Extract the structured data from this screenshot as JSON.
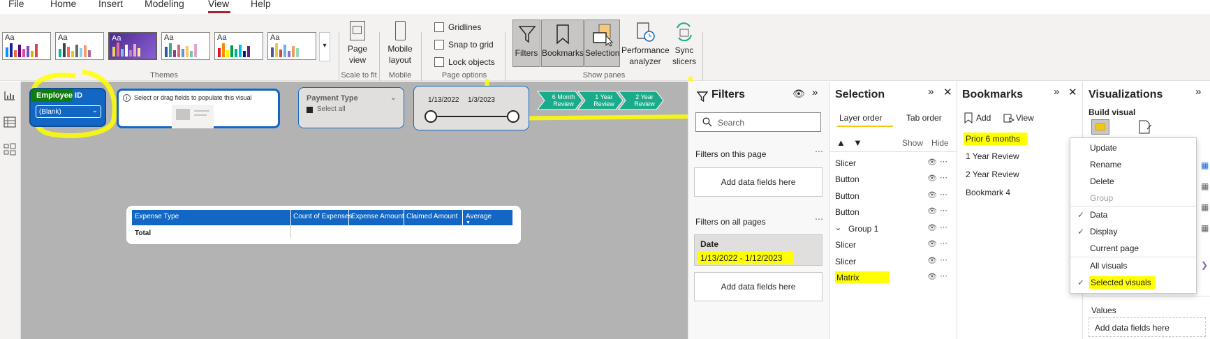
{
  "menu": {
    "file": "File",
    "home": "Home",
    "insert": "Insert",
    "modeling": "Modeling",
    "view": "View",
    "help": "Help"
  },
  "ribbon": {
    "theme_label": "Aa",
    "groups": {
      "themes": "Themes",
      "scale": "Scale to fit",
      "mobile": "Mobile",
      "page_options": "Page options",
      "show_panes": "Show panes"
    },
    "page_view": "Page view",
    "mobile_layout": "Mobile layout",
    "gridlines": "Gridlines",
    "snap_to_grid": "Snap to grid",
    "lock_objects": "Lock objects",
    "filters": "Filters",
    "bookmarks": "Bookmarks",
    "selection": "Selection",
    "performance_analyzer": "Performance analyzer",
    "sync_slicers": "Sync slicers"
  },
  "canvas": {
    "employee_slicer": {
      "title": "Employee ID",
      "value": "(Blank)"
    },
    "placeholder_text": "Select or drag fields to populate this visual",
    "payment_slicer": {
      "title": "Payment Type",
      "item": "Select all"
    },
    "date_slicer": {
      "start": "1/13/2022",
      "end": "1/3/2023"
    },
    "chevrons": [
      "6 Month Review",
      "1 Year Review",
      "2 Year Review"
    ],
    "matrix": {
      "columns": [
        "Expense Type",
        "Count of Expenses",
        "Expense Amount",
        "Claimed Amount",
        "Average"
      ],
      "total": "Total"
    }
  },
  "filters": {
    "title": "Filters",
    "search_placeholder": "Search",
    "on_this_page": "Filters on this page",
    "add_fields": "Add data fields here",
    "on_all_pages": "Filters on all pages",
    "date_card": {
      "title": "Date",
      "value": "1/13/2022 - 1/12/2023"
    },
    "add_fields_2": "Add data fields here"
  },
  "selection": {
    "title": "Selection",
    "tabs": [
      "Layer order",
      "Tab order"
    ],
    "show": "Show",
    "hide": "Hide",
    "items": [
      "Slicer",
      "Button",
      "Button",
      "Button",
      "Group 1",
      "Slicer",
      "Slicer",
      "Matrix"
    ]
  },
  "bookmarks": {
    "title": "Bookmarks",
    "add": "Add",
    "view": "View",
    "items": [
      "Prior 6 months",
      "1 Year Review",
      "2 Year Review",
      "Bookmark 4"
    ]
  },
  "visualizations": {
    "title": "Visualizations",
    "build_visual": "Build visual",
    "values": "Values",
    "add_fields": "Add data fields here"
  },
  "context_menu": {
    "items": [
      "Update",
      "Rename",
      "Delete",
      "Group",
      "Data",
      "Display",
      "Current page",
      "All visuals",
      "Selected visuals"
    ]
  },
  "colors": {
    "accent": "#f2c811",
    "highlight": "#ffff00",
    "teal": "#1aab8a",
    "blue": "#1267c4"
  }
}
